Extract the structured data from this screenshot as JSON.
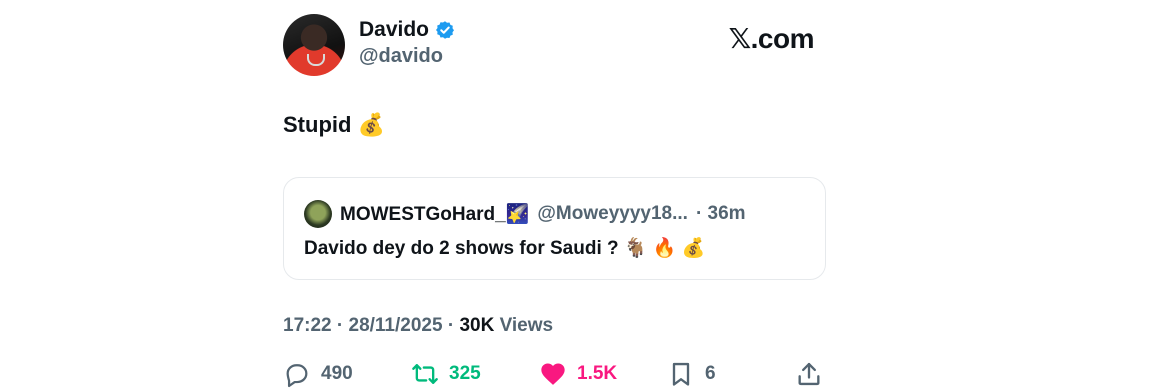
{
  "author": {
    "display_name": "Davido",
    "handle": "@davido",
    "verified_icon": "verified-badge-icon",
    "accent": "#1d9bf0"
  },
  "brand": {
    "logo_x": "𝕏",
    "logo_text": ".com"
  },
  "tweet": {
    "text": "Stupid 💰"
  },
  "quoted": {
    "display_name": "MOWESTGoHard_🌠",
    "handle": "@Moweyyyy18...",
    "time": "· 36m",
    "text": "Davido dey do 2 shows for Saudi ? 🐐 🔥 💰"
  },
  "meta": {
    "time": "17:22",
    "date": "28/11/2025",
    "sep": "·",
    "views_count": "30K",
    "views_label": "Views"
  },
  "actions": {
    "replies": "490",
    "retweets": "325",
    "likes": "1.5K",
    "bookmarks": "6"
  },
  "colors": {
    "text": "#0f1419",
    "secondary": "#536471",
    "retweet": "#00ba7c",
    "like": "#f91880"
  }
}
